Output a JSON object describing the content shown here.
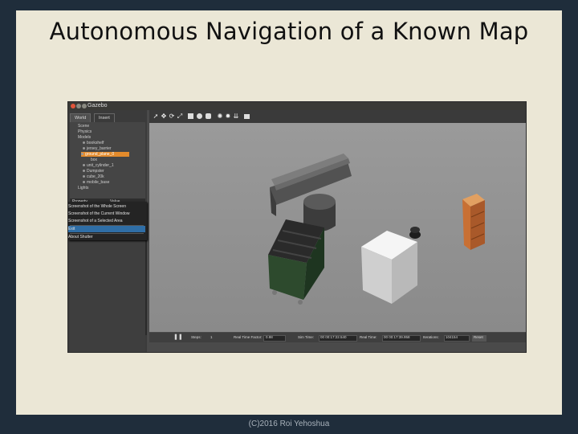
{
  "slide": {
    "title": "Autonomous Navigation of a Known Map",
    "footer": "(C)2016 Roi Yehoshua"
  },
  "app": {
    "window_title": "Gazebo",
    "tabs": [
      "World",
      "Insert"
    ],
    "tree": [
      "Scene",
      "Physics",
      "Models",
      "bookshelf",
      "jersey_barrier",
      "ground_plane_0",
      "box",
      "unit_cylinder_1",
      "Dumpster",
      "cube_20k",
      "mobile_base",
      "Lights"
    ],
    "selected_tree_item": "ground_plane_0",
    "props_header": [
      "Property",
      "Value"
    ],
    "context_menu": [
      "Screenshot of the Whole Screen",
      "Screenshot of the Current Window",
      "Screenshot of a Selected Area",
      "Exit",
      "About Shutter"
    ],
    "status": {
      "play_icon": "pause-icon",
      "steps_label": "Steps:",
      "steps_value": "1",
      "rtf_label": "Real Time Factor:",
      "rtf_value": "0.98",
      "sim_label": "Sim Time:",
      "sim_value": "00 00:17:22.540",
      "real_label": "Real Time:",
      "real_value": "00 00:17:39.958",
      "iter_label": "Iterations:",
      "iter_value": "104154",
      "reset_label": "Reset"
    }
  },
  "colors": {
    "slide_bg": "#ebe7d6",
    "frame_bg": "#1f2d3b",
    "selection": "#e38b2c",
    "menu_highlight": "#2f6ea6"
  }
}
